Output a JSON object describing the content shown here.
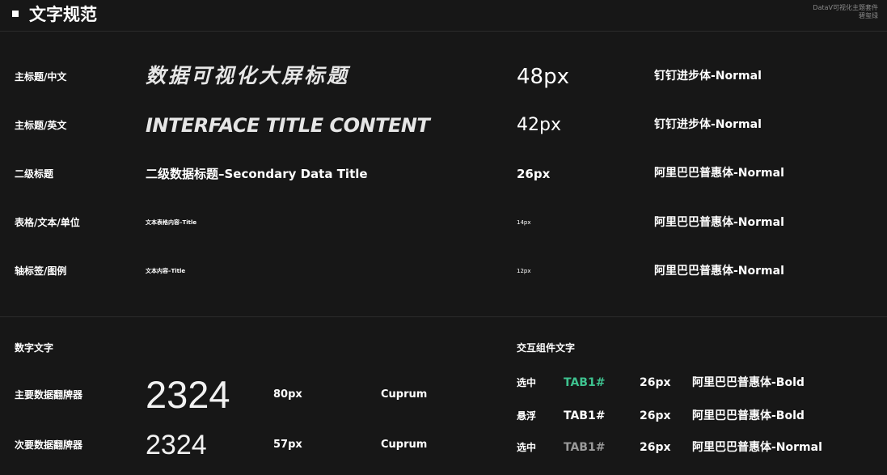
{
  "header": {
    "title": "文字规范",
    "corner_line1": "DataV可视化主题套件",
    "corner_line2": "碧玺绿"
  },
  "type_rows": [
    {
      "label": "主标题/中文",
      "sample": "数据可视化大屏标题",
      "size": "48px",
      "font": "钉钉进步体-Normal"
    },
    {
      "label": "主标题/英文",
      "sample": "INTERFACE TITLE CONTENT",
      "size": "42px",
      "font": "钉钉进步体-Normal"
    },
    {
      "label": "二级标题",
      "sample": "二级数据标题–Secondary Data Title",
      "size": "26px",
      "font": "阿里巴巴普惠体-Normal"
    },
    {
      "label": "表格/文本/单位",
      "sample": "文本表格内容–Title",
      "size": "14px",
      "font": "阿里巴巴普惠体-Normal"
    },
    {
      "label": "轴标签/图例",
      "sample": "文本内容–Title",
      "size": "12px",
      "font": "阿里巴巴普惠体-Normal"
    }
  ],
  "numbers": {
    "heading": "数字文字",
    "rows": [
      {
        "label": "主要数据翻牌器",
        "sample": "2324",
        "size": "80px",
        "font": "Cuprum"
      },
      {
        "label": "次要数据翻牌器",
        "sample": "2324",
        "size": "57px",
        "font": "Cuprum"
      }
    ]
  },
  "interactive": {
    "heading": "交互组件文字",
    "rows": [
      {
        "state": "选中",
        "tab": "TAB1#",
        "size": "26px",
        "font": "阿里巴巴普惠体-Bold",
        "tab_color": "#3ec28f"
      },
      {
        "state": "悬浮",
        "tab": "TAB1#",
        "size": "26px",
        "font": "阿里巴巴普惠体-Bold",
        "tab_color": "#ffffff"
      },
      {
        "state": "选中",
        "tab": "TAB1#",
        "size": "26px",
        "font": "阿里巴巴普惠体-Normal",
        "tab_color": "#9a9a9a"
      }
    ]
  },
  "colors": {
    "background": "#171717",
    "accent": "#3ec28f"
  }
}
